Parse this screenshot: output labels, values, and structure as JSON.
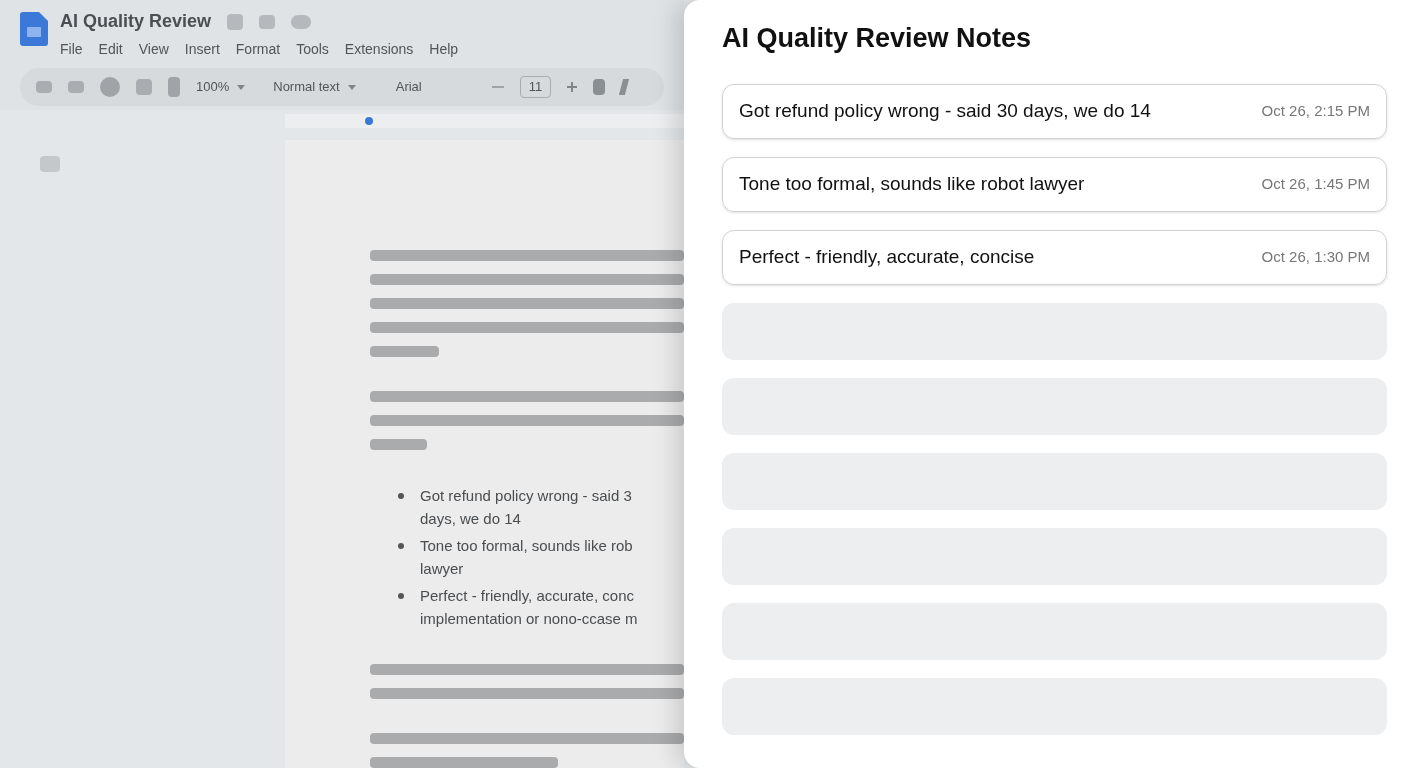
{
  "document": {
    "title": "AI Quality Review",
    "menu": [
      "File",
      "Edit",
      "View",
      "Insert",
      "Format",
      "Tools",
      "Extensions",
      "Help"
    ],
    "toolbar": {
      "zoom": "100%",
      "style": "Normal text",
      "font": "Arial",
      "size": "11"
    },
    "bullets": [
      {
        "lines": [
          "Got refund policy wrong - said 3",
          "days, we do 14"
        ]
      },
      {
        "lines": [
          "Tone too formal, sounds like rob",
          "lawyer"
        ]
      },
      {
        "lines": [
          "Perfect - friendly, accurate, conc",
          "implementation or nono-ccase m"
        ]
      }
    ]
  },
  "panel": {
    "title": "AI Quality Review Notes",
    "notes": [
      {
        "kind": "note",
        "text": "Got refund policy wrong - said 30 days, we do 14",
        "time": "Oct 26, 2:15 PM"
      },
      {
        "kind": "note",
        "text": "Tone too formal, sounds like robot lawyer",
        "time": "Oct 26, 1:45 PM"
      },
      {
        "kind": "note",
        "text": "Perfect - friendly, accurate, concise",
        "time": "Oct 26, 1:30 PM"
      },
      {
        "kind": "placeholder"
      },
      {
        "kind": "placeholder"
      },
      {
        "kind": "placeholder"
      },
      {
        "kind": "placeholder"
      },
      {
        "kind": "placeholder"
      },
      {
        "kind": "placeholder"
      }
    ]
  }
}
